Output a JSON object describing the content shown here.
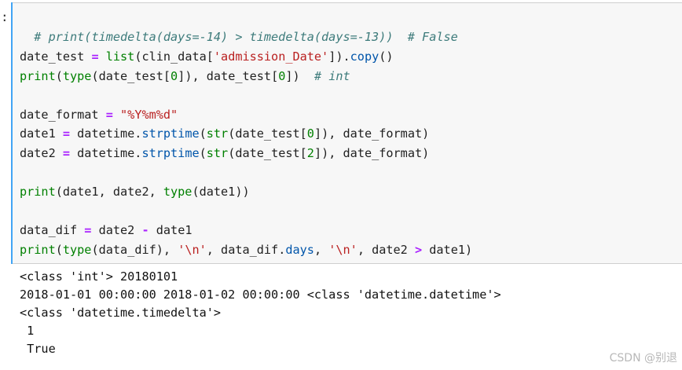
{
  "prompt": ":",
  "code": {
    "line1_comment": "# print(timedelta(days=-14) > timedelta(days=-13))  # False",
    "line3": {
      "var": "date_test",
      "eq": " = ",
      "fn_list": "list",
      "p1": "(clin_data[",
      "str": "'admission_Date'",
      "p2": "]).",
      "copy": "copy",
      "p3": "()"
    },
    "line4": {
      "print": "print",
      "p1": "(",
      "type": "type",
      "p2": "(date_test[",
      "zero1": "0",
      "p3": "]), date_test[",
      "zero2": "0",
      "p4": "])  ",
      "comment": "# int"
    },
    "line6": {
      "var": "date_format",
      "eq": " = ",
      "str": "\"%Y%m%d\""
    },
    "line7": {
      "var": "date1",
      "eq": " = ",
      "obj": "datetime.",
      "method": "strptime",
      "p1": "(",
      "str_fn": "str",
      "p2": "(date_test[",
      "idx": "0",
      "p3": "]), date_format)"
    },
    "line8": {
      "var": "date2",
      "eq": " = ",
      "obj": "datetime.",
      "method": "strptime",
      "p1": "(",
      "str_fn": "str",
      "p2": "(date_test[",
      "idx": "2",
      "p3": "]), date_format)"
    },
    "line10": {
      "print": "print",
      "p1": "(date1, date2, ",
      "type": "type",
      "p2": "(date1))"
    },
    "line12": {
      "var": "data_dif",
      "eq": " = ",
      "rest1": "date2 ",
      "minus": "-",
      "rest2": " date1"
    },
    "line13": {
      "print": "print",
      "p1": "(",
      "type": "type",
      "p2": "(data_dif), ",
      "nl1": "'\\n'",
      "p3": ", data_dif.",
      "days": "days",
      "p4": ", ",
      "nl2": "'\\n'",
      "p5": ", date2 ",
      "gt": ">",
      "p6": " date1)"
    }
  },
  "output": {
    "lines": [
      "<class 'int'> 20180101",
      "2018-01-01 00:00:00 2018-01-02 00:00:00 <class 'datetime.datetime'>",
      "<class 'datetime.timedelta'>",
      " 1",
      " True"
    ]
  },
  "watermark": "CSDN @别退"
}
